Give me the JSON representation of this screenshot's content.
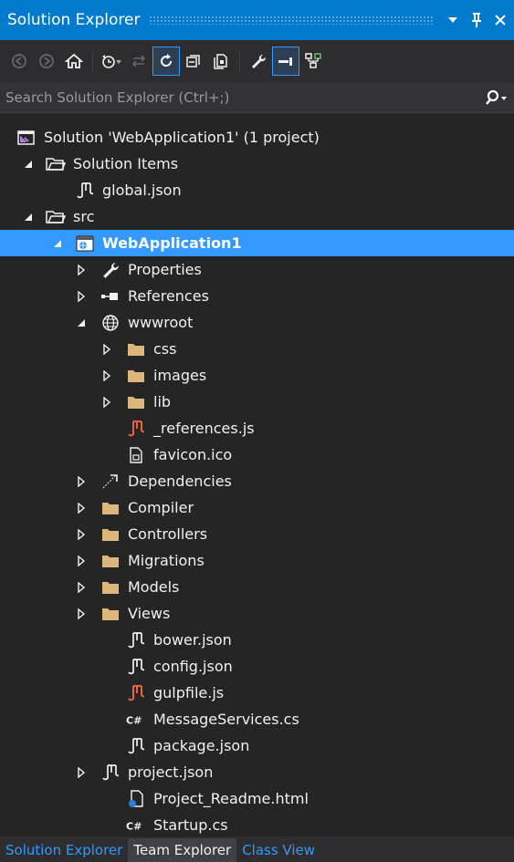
{
  "window": {
    "title": "Solution Explorer",
    "title_buttons": [
      "dropdown-icon",
      "pin-icon",
      "close-icon"
    ]
  },
  "toolbar": {
    "items": [
      "back-icon",
      "forward-icon",
      "home-icon",
      "pending-changes-icon",
      "sync-icon",
      "refresh-icon",
      "collapse-all-icon",
      "show-all-files-icon",
      "properties-icon",
      "preview-icon",
      "view-class-diagram-icon"
    ]
  },
  "search": {
    "placeholder": "Search Solution Explorer (Ctrl+;)"
  },
  "tree": {
    "items": [
      {
        "label": "Solution 'WebApplication1' (1 project)",
        "icon": "solution-icon",
        "expander": "none",
        "level": 0
      },
      {
        "label": "Solution Items",
        "icon": "folder-open-icon",
        "expander": "expanded",
        "level": 1
      },
      {
        "label": "global.json",
        "icon": "json-file-icon",
        "expander": "none",
        "level": 2
      },
      {
        "label": "src",
        "icon": "folder-open-icon",
        "expander": "expanded",
        "level": 1
      },
      {
        "label": "WebApplication1",
        "icon": "web-project-icon",
        "expander": "expanded",
        "level": 2,
        "selected": true
      },
      {
        "label": "Properties",
        "icon": "wrench-icon",
        "expander": "collapsed",
        "level": 3
      },
      {
        "label": "References",
        "icon": "references-icon",
        "expander": "collapsed",
        "level": 3
      },
      {
        "label": "wwwroot",
        "icon": "globe-icon",
        "expander": "expanded",
        "level": 3
      },
      {
        "label": "css",
        "icon": "folder-icon",
        "expander": "collapsed",
        "level": 4
      },
      {
        "label": "images",
        "icon": "folder-icon",
        "expander": "collapsed",
        "level": 4
      },
      {
        "label": "lib",
        "icon": "folder-icon",
        "expander": "collapsed",
        "level": 4
      },
      {
        "label": "_references.js",
        "icon": "js-file-icon",
        "expander": "none",
        "level": 5
      },
      {
        "label": "favicon.ico",
        "icon": "ico-file-icon",
        "expander": "none",
        "level": 5
      },
      {
        "label": "Dependencies",
        "icon": "dependencies-icon",
        "expander": "collapsed",
        "level": 3
      },
      {
        "label": "Compiler",
        "icon": "folder-icon",
        "expander": "collapsed",
        "level": 3
      },
      {
        "label": "Controllers",
        "icon": "folder-icon",
        "expander": "collapsed",
        "level": 3
      },
      {
        "label": "Migrations",
        "icon": "folder-icon",
        "expander": "collapsed",
        "level": 3
      },
      {
        "label": "Models",
        "icon": "folder-icon",
        "expander": "collapsed",
        "level": 3
      },
      {
        "label": "Views",
        "icon": "folder-icon",
        "expander": "collapsed",
        "level": 3
      },
      {
        "label": "bower.json",
        "icon": "json-file-icon",
        "expander": "none",
        "level": 4
      },
      {
        "label": "config.json",
        "icon": "json-file-icon",
        "expander": "none",
        "level": 4
      },
      {
        "label": "gulpfile.js",
        "icon": "js-file-icon",
        "expander": "none",
        "level": 4
      },
      {
        "label": "MessageServices.cs",
        "icon": "csharp-file-icon",
        "expander": "none",
        "level": 4
      },
      {
        "label": "package.json",
        "icon": "json-file-icon",
        "expander": "none",
        "level": 4
      },
      {
        "label": "project.json",
        "icon": "json-file-icon",
        "expander": "collapsed",
        "level": 3
      },
      {
        "label": "Project_Readme.html",
        "icon": "html-file-icon",
        "expander": "none",
        "level": 4
      },
      {
        "label": "Startup.cs",
        "icon": "csharp-file-icon",
        "expander": "none",
        "level": 4
      }
    ]
  },
  "tabs": [
    {
      "label": "Solution Explorer",
      "active": true
    },
    {
      "label": "Team Explorer",
      "active": false
    },
    {
      "label": "Class View",
      "active": false
    }
  ],
  "colors": {
    "accent": "#007acc",
    "selection": "#3399ff",
    "background": "#252526",
    "folder": "#dcb67a",
    "js": "#e8643c",
    "icon": "#f1f1f1"
  }
}
